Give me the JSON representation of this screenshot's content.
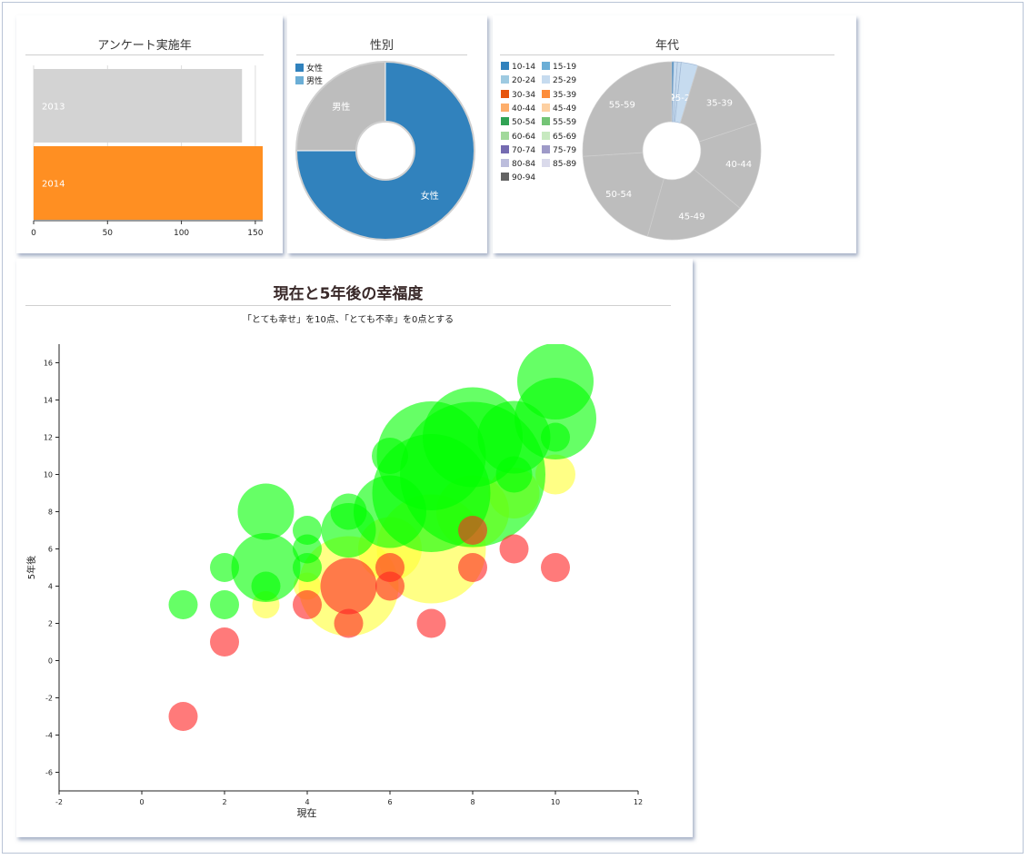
{
  "panels": {
    "year": {
      "title": "アンケート実施年"
    },
    "gender": {
      "title": "性別"
    },
    "age": {
      "title": "年代"
    },
    "happiness": {
      "title": "現在と5年後の幸福度",
      "subtitle": "「とても幸せ」を10点、「とても不幸」を0点とする"
    }
  },
  "colors": {
    "orange": "#ff8f22",
    "light_gray": "#d3d3d3",
    "blue": "#3182bd",
    "pie_gray": "#bdbdbd",
    "bubble_green": "#00ff00",
    "bubble_yellow": "#ffff33",
    "bubble_red": "#ff2222"
  },
  "chart_data": [
    {
      "type": "bar",
      "title": "アンケート実施年",
      "categories": [
        "2013",
        "2014"
      ],
      "values": [
        141,
        155
      ],
      "xlim": [
        0,
        155
      ],
      "xticks": [
        "0",
        "50",
        "100",
        "150"
      ],
      "grid": true
    },
    {
      "type": "pie",
      "title": "性別",
      "labels": [
        "女性",
        "男性"
      ],
      "values": [
        222,
        74
      ],
      "legend": [
        "女性",
        "男性"
      ],
      "legend_placement": "top-left"
    },
    {
      "type": "pie",
      "title": "年代",
      "legend": [
        "10-14",
        "15-19",
        "20-24",
        "25-29",
        "30-34",
        "35-39",
        "40-44",
        "45-49",
        "50-54",
        "55-59",
        "60-64",
        "65-69",
        "70-74",
        "75-79",
        "80-84",
        "85-89",
        "90-94"
      ],
      "legend_colors": [
        "#3182bd",
        "#6baed6",
        "#9ecae1",
        "#c6dbef",
        "#e6550d",
        "#fd8d3c",
        "#fdae6b",
        "#fdd0a2",
        "#31a354",
        "#74c476",
        "#a1d99b",
        "#c7e9c0",
        "#756bb1",
        "#9e9ac8",
        "#bcbddc",
        "#dadaeb",
        "#636363"
      ],
      "slices": [
        {
          "label": "10-14",
          "value": 1
        },
        {
          "label": "15-19",
          "value": 2
        },
        {
          "label": "20-24",
          "value": 2
        },
        {
          "label": "25-29",
          "value": 9
        },
        {
          "label": "35-39",
          "value": 45
        },
        {
          "label": "40-44",
          "value": 48
        },
        {
          "label": "45-49",
          "value": 54
        },
        {
          "label": "50-54",
          "value": 58
        },
        {
          "label": "55-59",
          "value": 77
        }
      ],
      "legend_placement": "left"
    },
    {
      "type": "scatter",
      "title": "現在と5年後の幸福度",
      "subtitle": "「とても幸せ」を10点、「とても不幸」を0点とする",
      "xlabel": "現在",
      "ylabel": "5年後",
      "xlim": [
        -2,
        12
      ],
      "ylim": [
        -7,
        17
      ],
      "xticks": [
        "-2",
        "0",
        "2",
        "4",
        "6",
        "8",
        "10",
        "12"
      ],
      "yticks": [
        "-6",
        "-4",
        "-2",
        "0",
        "2",
        "4",
        "6",
        "8",
        "10",
        "12",
        "14",
        "16"
      ],
      "points": [
        {
          "x": 5,
          "y": 4,
          "r": 55,
          "color": "yellow"
        },
        {
          "x": 7,
          "y": 6,
          "r": 60,
          "color": "yellow"
        },
        {
          "x": 8,
          "y": 8,
          "r": 40,
          "color": "yellow"
        },
        {
          "x": 6,
          "y": 6,
          "r": 35,
          "color": "yellow"
        },
        {
          "x": 10,
          "y": 10,
          "r": 22,
          "color": "yellow"
        },
        {
          "x": 3,
          "y": 3,
          "r": 15,
          "color": "yellow"
        },
        {
          "x": 4,
          "y": 4,
          "r": 15,
          "color": "yellow"
        },
        {
          "x": 9,
          "y": 9,
          "r": 28,
          "color": "yellow"
        },
        {
          "x": 1,
          "y": 3,
          "r": 16,
          "color": "green"
        },
        {
          "x": 2,
          "y": 3,
          "r": 16,
          "color": "green"
        },
        {
          "x": 2,
          "y": 5,
          "r": 16,
          "color": "green"
        },
        {
          "x": 3,
          "y": 5,
          "r": 38,
          "color": "green"
        },
        {
          "x": 3,
          "y": 8,
          "r": 31,
          "color": "green"
        },
        {
          "x": 3,
          "y": 4,
          "r": 16,
          "color": "green"
        },
        {
          "x": 4,
          "y": 7,
          "r": 16,
          "color": "green"
        },
        {
          "x": 4,
          "y": 6,
          "r": 16,
          "color": "green"
        },
        {
          "x": 4,
          "y": 5,
          "r": 16,
          "color": "green"
        },
        {
          "x": 5,
          "y": 8,
          "r": 20,
          "color": "green"
        },
        {
          "x": 5,
          "y": 7,
          "r": 30,
          "color": "green"
        },
        {
          "x": 6,
          "y": 8,
          "r": 40,
          "color": "green"
        },
        {
          "x": 6,
          "y": 11,
          "r": 20,
          "color": "green"
        },
        {
          "x": 7,
          "y": 9,
          "r": 65,
          "color": "green"
        },
        {
          "x": 7,
          "y": 11,
          "r": 60,
          "color": "green"
        },
        {
          "x": 8,
          "y": 10,
          "r": 80,
          "color": "green"
        },
        {
          "x": 8,
          "y": 12,
          "r": 55,
          "color": "green"
        },
        {
          "x": 9,
          "y": 12,
          "r": 40,
          "color": "green"
        },
        {
          "x": 9,
          "y": 10,
          "r": 20,
          "color": "green"
        },
        {
          "x": 10,
          "y": 13,
          "r": 45,
          "color": "green"
        },
        {
          "x": 10,
          "y": 15,
          "r": 42,
          "color": "green"
        },
        {
          "x": 10,
          "y": 12,
          "r": 16,
          "color": "green"
        },
        {
          "x": 1,
          "y": -3,
          "r": 16,
          "color": "red"
        },
        {
          "x": 2,
          "y": 1,
          "r": 16,
          "color": "red"
        },
        {
          "x": 4,
          "y": 3,
          "r": 16,
          "color": "red"
        },
        {
          "x": 5,
          "y": 4,
          "r": 31,
          "color": "red"
        },
        {
          "x": 5,
          "y": 2,
          "r": 16,
          "color": "red"
        },
        {
          "x": 6,
          "y": 5,
          "r": 16,
          "color": "red"
        },
        {
          "x": 6,
          "y": 4,
          "r": 16,
          "color": "red"
        },
        {
          "x": 7,
          "y": 2,
          "r": 16,
          "color": "red"
        },
        {
          "x": 8,
          "y": 7,
          "r": 16,
          "color": "red"
        },
        {
          "x": 8,
          "y": 5,
          "r": 16,
          "color": "red"
        },
        {
          "x": 9,
          "y": 6,
          "r": 16,
          "color": "red"
        },
        {
          "x": 10,
          "y": 5,
          "r": 16,
          "color": "red"
        }
      ]
    }
  ]
}
